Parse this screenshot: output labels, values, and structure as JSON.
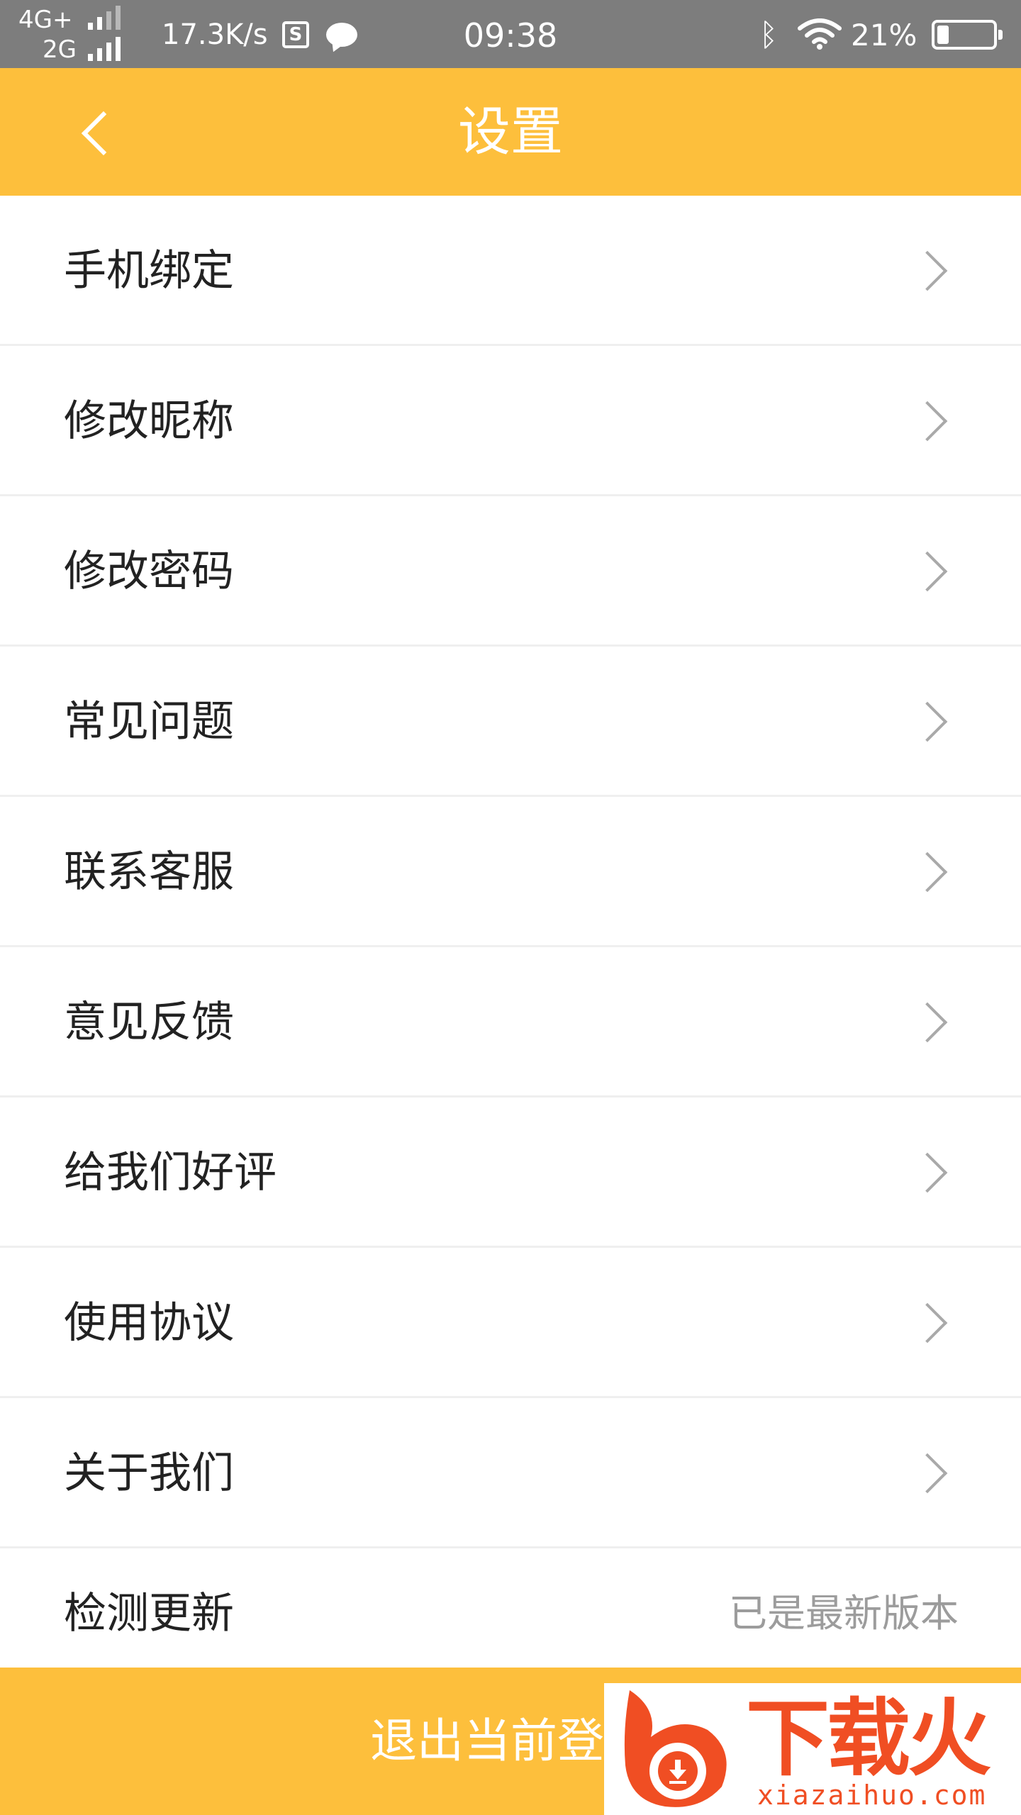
{
  "status_bar": {
    "network_1": "4G+",
    "network_2": "2G",
    "speed": "17.3K/s",
    "s_icon_glyph": "S",
    "time": "09:38",
    "bt_glyph": "ᛒ",
    "battery_percent": "21%",
    "battery_level": 0.21
  },
  "header": {
    "title": "设置",
    "back_icon": "chevron-left-icon"
  },
  "menu": {
    "items": [
      {
        "label": "手机绑定"
      },
      {
        "label": "修改昵称"
      },
      {
        "label": "修改密码"
      },
      {
        "label": "常见问题"
      },
      {
        "label": "联系客服"
      },
      {
        "label": "意见反馈"
      },
      {
        "label": "给我们好评"
      },
      {
        "label": "使用协议"
      },
      {
        "label": "关于我们"
      }
    ],
    "update": {
      "label": "检测更新",
      "status": "已是最新版本"
    }
  },
  "logout": {
    "label": "退出当前登录"
  },
  "watermark": {
    "text": "下载火",
    "url": "xiazaihuo.com"
  },
  "colors": {
    "accent": "#fdbf3c",
    "status_bar": "#7d7d7d",
    "text_primary": "#222222",
    "text_secondary": "#9c9c9c",
    "watermark": "#f04e23"
  }
}
